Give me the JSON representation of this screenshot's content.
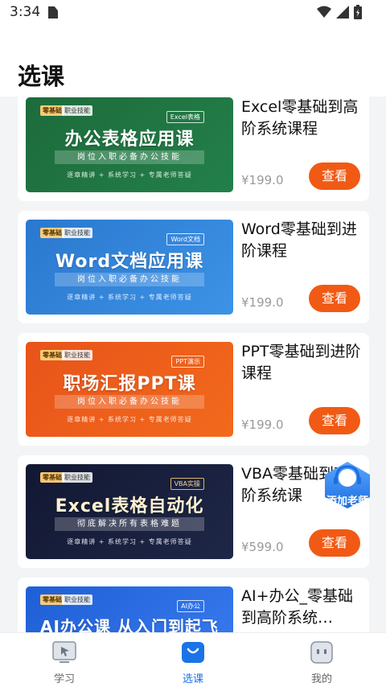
{
  "status": {
    "time": "3:34"
  },
  "header": {
    "title": "选课"
  },
  "courses": [
    {
      "title": "Excel零基础到高阶系统课程",
      "price": "¥199.0",
      "button": "查看",
      "thumb": {
        "tag_left": "零基础",
        "tag_left2": "职业技能",
        "tag_right": "Excel表格",
        "headline": "办公表格应用课",
        "band": "岗位入职必备办公技能",
        "foot": "逐章精讲 + 系统学习 + 专属老师答疑",
        "bg": "#1f6a3a"
      }
    },
    {
      "title": "Word零基础到进阶课程",
      "price": "¥199.0",
      "button": "查看",
      "thumb": {
        "tag_left": "零基础",
        "tag_left2": "职业技能",
        "tag_right": "Word文档",
        "headline": "Word文档应用课",
        "band": "岗位入职必备办公技能",
        "foot": "逐章精讲 + 系统学习 + 专属老师答疑",
        "bg": "#2c7fd6"
      }
    },
    {
      "title": "PPT零基础到进阶课程",
      "price": "¥199.0",
      "button": "查看",
      "thumb": {
        "tag_left": "零基础",
        "tag_left2": "职业技能",
        "tag_right": "PPT演示",
        "headline": "职场汇报PPT课",
        "band": "岗位入职必备办公技能",
        "foot": "逐章精讲 + 系统学习 + 专属老师答疑",
        "bg": "#ec5a15"
      }
    },
    {
      "title": "VBA零基础到高阶系统课",
      "price": "¥599.0",
      "button": "查看",
      "thumb": {
        "tag_left": "零基础",
        "tag_left2": "职业技能",
        "tag_right": "VBA实操",
        "headline": "Excel表格自动化",
        "band": "彻底解决所有表格难题",
        "foot": "逐章精讲 + 系统学习 + 专属老师答疑",
        "bg": "#151b34"
      }
    },
    {
      "title": "AI+办公_零基础到高阶系统…",
      "price": "",
      "button": "",
      "thumb": {
        "tag_left": "零基础",
        "tag_left2": "职业技能",
        "tag_right": "AI办公",
        "headline": "AI办公课 从入门到起飞",
        "band": "",
        "foot": "",
        "bg": "#2563d8"
      }
    }
  ],
  "floating": {
    "label": "添加老师"
  },
  "tabbar": [
    {
      "label": "学习",
      "icon": "study-icon"
    },
    {
      "label": "选课",
      "icon": "shopping-bag-icon",
      "active": true
    },
    {
      "label": "我的",
      "icon": "profile-icon"
    }
  ],
  "colors": {
    "accent": "#f15a14",
    "tab_active": "#1a73e8"
  }
}
